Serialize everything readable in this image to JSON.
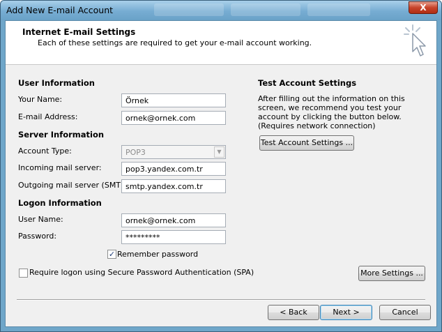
{
  "window": {
    "title": "Add New E-mail Account",
    "close_label": "X"
  },
  "header": {
    "title": "Internet E-mail Settings",
    "subtitle": "Each of these settings are required to get your e-mail account working."
  },
  "user_info": {
    "heading": "User Information",
    "name_label": "Your Name:",
    "name_value": "Örnek",
    "email_label": "E-mail Address:",
    "email_value": "ornek@ornek.com"
  },
  "server_info": {
    "heading": "Server Information",
    "account_type_label": "Account Type:",
    "account_type_value": "POP3",
    "incoming_label": "Incoming mail server:",
    "incoming_value": "pop3.yandex.com.tr",
    "outgoing_label": "Outgoing mail server (SMTP):",
    "outgoing_value": "smtp.yandex.com.tr"
  },
  "logon_info": {
    "heading": "Logon Information",
    "username_label": "User Name:",
    "username_value": "ornek@ornek.com",
    "password_label": "Password:",
    "password_value": "*********",
    "remember_label": "Remember password",
    "remember_checked": true,
    "spa_label": "Require logon using Secure Password Authentication (SPA)",
    "spa_checked": false
  },
  "test_settings": {
    "heading": "Test Account Settings",
    "description": "After filling out the information on this screen, we recommend you test your account by clicking the button below. (Requires network connection)",
    "button_label": "Test Account Settings ..."
  },
  "more_settings_label": "More Settings ...",
  "footer": {
    "back_label": "< Back",
    "next_label": "Next >",
    "cancel_label": "Cancel"
  },
  "icons": {
    "header_icon": "cursor-sparkle-icon",
    "close": "close-icon",
    "dropdown": "chevron-down-icon",
    "check": "checkmark-icon"
  }
}
